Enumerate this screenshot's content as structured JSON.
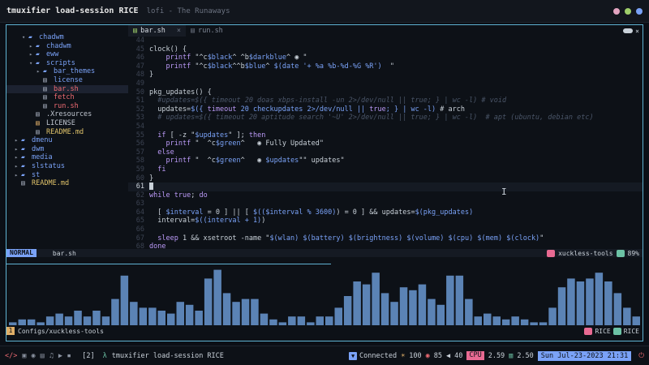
{
  "titlebar": {
    "title": "tmuxifier load-session RICE",
    "subtitle": "lofi - The Runaways",
    "dots": [
      "#e2a4c0",
      "#9ece6a",
      "#7aa2f7"
    ]
  },
  "tree": [
    {
      "indent": 1,
      "chev": "▾",
      "icon": "folder",
      "label": "chadwm",
      "color": "blue"
    },
    {
      "indent": 2,
      "chev": "▸",
      "icon": "folder",
      "label": "chadwm",
      "color": "blue"
    },
    {
      "indent": 2,
      "chev": "▸",
      "icon": "folder",
      "label": "eww",
      "color": "blue"
    },
    {
      "indent": 2,
      "chev": "▾",
      "icon": "folder",
      "label": "scripts",
      "color": "blue"
    },
    {
      "indent": 3,
      "chev": "▸",
      "icon": "folder",
      "label": "bar_themes",
      "color": "blue"
    },
    {
      "indent": 3,
      "chev": "",
      "icon": "file",
      "label": "license",
      "color": "blue"
    },
    {
      "indent": 3,
      "chev": "",
      "icon": "file",
      "label": "bar.sh",
      "color": "red",
      "selected": true
    },
    {
      "indent": 3,
      "chev": "",
      "icon": "file",
      "label": "fetch",
      "color": "red"
    },
    {
      "indent": 3,
      "chev": "",
      "icon": "file",
      "label": "run.sh",
      "color": "red"
    },
    {
      "indent": 2,
      "chev": "",
      "icon": "file",
      "label": ".Xresources",
      "color": "grey"
    },
    {
      "indent": 2,
      "chev": "",
      "icon": "fileo",
      "label": "LICENSE",
      "color": "grey"
    },
    {
      "indent": 2,
      "chev": "",
      "icon": "file",
      "label": "README.md",
      "color": "yellow"
    },
    {
      "indent": 0,
      "chev": "▸",
      "icon": "folder",
      "label": "dmenu",
      "color": "blue"
    },
    {
      "indent": 0,
      "chev": "▸",
      "icon": "folder",
      "label": "dwm",
      "color": "blue"
    },
    {
      "indent": 0,
      "chev": "▸",
      "icon": "folder",
      "label": "media",
      "color": "blue"
    },
    {
      "indent": 0,
      "chev": "▸",
      "icon": "folder",
      "label": "slstatus",
      "color": "blue"
    },
    {
      "indent": 0,
      "chev": "▸",
      "icon": "folder",
      "label": "st",
      "color": "blue"
    },
    {
      "indent": 0,
      "chev": "",
      "icon": "file",
      "label": "README.md",
      "color": "yellow"
    }
  ],
  "tabs": [
    {
      "label": "bar.sh",
      "active": true
    },
    {
      "label": "run.sh",
      "active": false
    }
  ],
  "code": [
    {
      "n": "44",
      "t": ""
    },
    {
      "n": "45",
      "t": "clock() {"
    },
    {
      "n": "46",
      "t": "    printf \"^c$black^ ^b$darkblue^ ◉ \""
    },
    {
      "n": "47",
      "t": "    printf \"^c$black^^b$blue^ $(date '+ %a %b-%d-%G %R')  \""
    },
    {
      "n": "48",
      "t": "}"
    },
    {
      "n": "49",
      "t": ""
    },
    {
      "n": "50",
      "t": "pkg_updates() {"
    },
    {
      "n": "51",
      "t": "  #updates=$({ timeout 20 doas xbps-install -un 2>/dev/null || true; } | wc -l) # void"
    },
    {
      "n": "52",
      "t": "  updates=$({ timeout 20 checkupdates 2>/dev/null || true; } | wc -l) # arch"
    },
    {
      "n": "53",
      "t": "  # updates=$({ timeout 20 aptitude search '~U' 2>/dev/null || true; } | wc -l)  # apt (ubuntu, debian etc)"
    },
    {
      "n": "54",
      "t": ""
    },
    {
      "n": "55",
      "t": "  if [ -z \"$updates\" ]; then"
    },
    {
      "n": "56",
      "t": "    printf \"  ^c$green^   ◉ Fully Updated\""
    },
    {
      "n": "57",
      "t": "  else"
    },
    {
      "n": "58",
      "t": "    printf \"  ^c$green^   ◉ $updates\"\" updates\""
    },
    {
      "n": "59",
      "t": "  fi"
    },
    {
      "n": "60",
      "t": "}"
    },
    {
      "n": "61",
      "t": "",
      "cursor": true
    },
    {
      "n": "62",
      "t": "while true; do"
    },
    {
      "n": "63",
      "t": ""
    },
    {
      "n": "64",
      "t": "  [ $interval = 0 ] || [ $(($interval % 3600)) = 0 ] && updates=$(pkg_updates)"
    },
    {
      "n": "65",
      "t": "  interval=$((interval + 1))"
    },
    {
      "n": "66",
      "t": ""
    },
    {
      "n": "67",
      "t": "  sleep 1 && xsetroot -name \"$(wlan) $(battery) $(brightness) $(volume) $(cpu) $(mem) $(clock)\""
    },
    {
      "n": "68",
      "t": "done"
    }
  ],
  "statusline": {
    "mode": "NORMAL",
    "file": "bar.sh",
    "project": "xuckless-tools",
    "percent": "89%"
  },
  "visualizer": {
    "progress": 0.51,
    "bars": [
      1,
      3,
      3,
      3,
      2,
      2,
      1,
      2,
      1,
      1,
      3,
      2,
      2,
      2,
      3,
      1,
      1,
      1,
      1,
      1,
      3,
      3,
      3,
      4,
      3,
      2,
      2,
      4,
      3,
      5,
      4,
      2,
      5,
      3,
      2,
      3,
      4,
      4,
      3,
      5,
      5,
      3,
      3,
      3,
      3,
      6,
      7,
      9,
      8,
      7,
      5,
      3,
      3,
      4,
      3,
      3,
      4,
      3,
      5,
      6,
      8,
      9,
      10,
      12,
      15,
      14,
      17,
      12,
      11,
      14,
      11,
      7,
      8,
      8,
      8,
      10,
      6,
      8,
      6,
      7,
      6,
      6,
      8,
      6,
      4,
      7,
      7,
      6,
      5,
      5,
      4,
      5,
      7,
      4,
      4,
      4,
      6,
      8,
      10,
      8,
      8,
      9,
      8,
      8,
      7,
      7,
      8,
      8,
      6,
      7,
      5,
      5,
      7,
      8,
      11,
      12,
      13,
      16,
      17,
      17,
      19,
      17,
      19,
      15,
      13,
      13,
      15,
      11,
      11,
      12,
      8,
      9,
      7,
      8,
      9,
      8,
      7,
      7,
      7,
      9,
      10,
      10,
      11,
      10,
      9,
      9,
      8,
      7,
      7,
      5,
      4,
      3,
      3,
      3,
      2,
      1,
      2,
      1,
      2,
      2,
      1,
      1,
      2,
      1,
      1,
      1,
      2,
      3,
      2,
      1,
      2,
      1,
      3,
      2,
      1,
      1,
      1,
      2,
      1,
      1,
      2,
      3,
      4,
      3,
      4,
      4,
      4,
      3,
      3,
      3,
      3,
      2,
      4,
      5,
      6,
      6,
      8,
      7,
      9,
      10,
      10,
      13,
      13,
      14,
      14,
      15,
      15,
      14,
      14,
      13,
      13,
      14,
      15,
      17,
      19,
      18,
      18,
      18,
      17,
      16,
      16,
      13,
      11,
      10,
      9,
      8,
      7,
      8,
      8,
      10,
      11,
      11,
      11,
      12,
      13,
      15,
      15,
      14,
      11,
      12,
      13,
      12,
      12,
      12,
      13,
      14,
      12,
      10,
      10,
      9,
      9,
      8,
      8,
      7,
      6,
      6,
      7,
      9,
      11,
      13,
      15,
      17,
      18,
      18,
      18,
      17,
      17,
      17,
      16,
      15,
      14,
      12,
      11,
      9,
      8,
      6,
      6,
      4,
      3,
      3,
      3,
      3,
      4,
      5,
      4,
      3,
      2,
      2,
      2,
      3,
      4,
      3,
      3,
      3,
      3,
      2,
      2,
      2,
      3,
      3,
      3,
      3,
      2,
      2,
      2,
      2,
      2,
      1,
      1,
      1,
      1,
      1,
      1,
      1,
      2,
      2,
      2,
      1,
      1,
      1,
      2,
      2,
      4,
      6,
      8,
      10,
      11,
      12,
      13,
      14,
      15,
      16,
      17,
      16,
      16,
      17,
      17,
      16,
      15,
      15,
      14,
      13,
      13,
      14,
      14,
      16,
      17,
      17,
      19,
      19,
      18,
      18,
      18,
      18,
      17,
      17,
      15,
      14,
      14,
      13,
      12,
      12,
      11,
      10,
      9,
      9,
      7,
      6,
      6,
      5,
      5,
      4,
      3,
      3,
      3,
      2,
      2,
      2,
      1
    ],
    "window_num": "1",
    "path": "Configs/xuckless-tools",
    "session_a": "RICE",
    "session_b": "RICE"
  },
  "bottombar": {
    "icons": [
      "</>",
      "▣",
      "◉",
      "▤",
      "♫",
      "▶",
      "⏹"
    ],
    "workspace": "[2]",
    "lambda": "λ",
    "title": "tmuxifier load-session RICE",
    "net_status": "Connected",
    "brightness": "100",
    "battery": "85",
    "volume": "40",
    "cpu_label": "CPU",
    "cpu_value": "2.59",
    "mem_value": "2.50",
    "datetime": "Sun Jul-23-2023 21:31"
  }
}
